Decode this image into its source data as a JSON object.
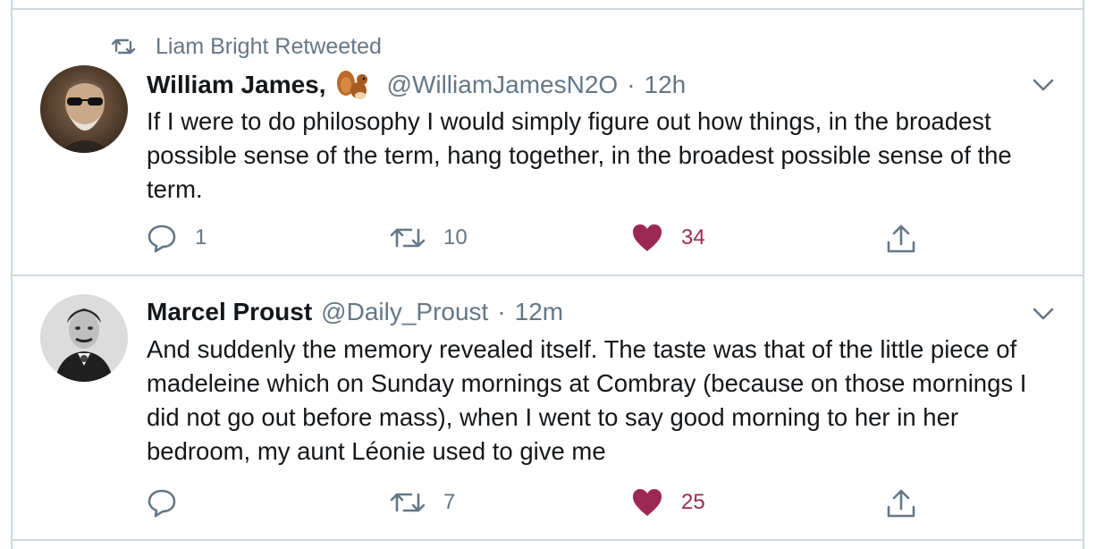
{
  "colors": {
    "border": "#cfd9de",
    "secondary_text": "#657786",
    "like": "#9d2853"
  },
  "tweets": [
    {
      "social_context": "Liam Bright Retweeted",
      "name": "William James,",
      "name_emoji": "squirrel",
      "handle": "@WilliamJamesN2O",
      "separator": "·",
      "time": "12h",
      "text": "If I were to do philosophy I would simply figure out how things, in the broadest possible sense of the term, hang together, in the broadest possible sense of the term.",
      "reply_count": "1",
      "retweet_count": "10",
      "like_count": "34",
      "liked": true
    },
    {
      "name": "Marcel Proust",
      "handle": "@Daily_Proust",
      "separator": "·",
      "time": "12m",
      "text": "And suddenly the memory revealed itself. The taste was that of the little piece of madeleine which on Sunday mornings at Combray (because on those mornings I did not go out before mass), when I went to say good morning to her in her bedroom, my aunt Léonie used to give me",
      "reply_count": "",
      "retweet_count": "7",
      "like_count": "25",
      "liked": true
    }
  ]
}
